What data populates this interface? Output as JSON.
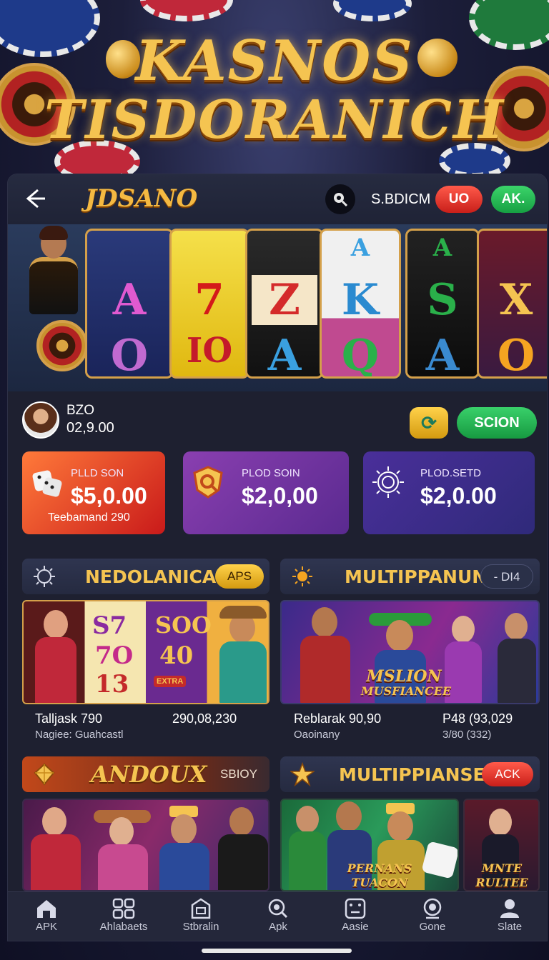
{
  "banner": {
    "line1": "KASNOS",
    "line2": "TISDORANICH"
  },
  "topbar": {
    "logo": "JDSANO",
    "user_label": "S.BDICM",
    "btn_red": "UO",
    "btn_green": "AK."
  },
  "slots": {
    "reels": [
      {
        "symbols": [
          "",
          "A",
          "O"
        ]
      },
      {
        "symbols": [
          "",
          "7",
          "IO"
        ]
      },
      {
        "symbols": [
          "",
          "Z",
          "A"
        ]
      },
      {
        "symbols": [
          "A",
          "K",
          "Q"
        ]
      },
      {
        "symbols": [
          "A",
          "S",
          "A"
        ]
      },
      {
        "symbols": [
          "",
          "X",
          "O"
        ]
      }
    ]
  },
  "profile": {
    "name": "BZO",
    "balance": "02,9.00",
    "login_label": "SCION"
  },
  "promo_cards": [
    {
      "label": "PLLD SON",
      "value": "$5,0.00",
      "sub": "Teebamand 290"
    },
    {
      "label": "PLOD SOIN",
      "value": "$2,0,00"
    },
    {
      "label": "PLOD.SETD",
      "value": "$2,0.00"
    }
  ],
  "sections": [
    {
      "title": "NEDOLANICA",
      "badge": "APS"
    },
    {
      "title": "MULTIPPANUN",
      "badge": "- DI4"
    },
    {
      "title": "ANDOUX",
      "badge": "SBIOY"
    },
    {
      "title": "MULTIPPIANSE",
      "badge": "ACK"
    }
  ],
  "game_cards": [
    {
      "name": "Talljask 790",
      "value": "290,08,230",
      "sub": "Nagiee: Guahcastl",
      "reel_text": [
        "S7",
        "7O",
        "13",
        "SOO",
        "40",
        "EXTRA"
      ]
    },
    {
      "name": "Reblarak 90,90",
      "value": "P48 (93,029",
      "sub": "Oaoinany",
      "sub2": "3/80 (332)",
      "art_text": [
        "MSLION",
        "MUSFIANCEE"
      ]
    }
  ],
  "bottom_art": {
    "left": "",
    "mid": [
      "PERNANS",
      "TUACON"
    ],
    "right": [
      "MNTE",
      "RULTEE"
    ]
  },
  "nav": [
    {
      "label": "APK",
      "icon": "home-icon"
    },
    {
      "label": "Ahlabaets",
      "icon": "grid-icon"
    },
    {
      "label": "Stbralin",
      "icon": "shop-icon"
    },
    {
      "label": "Apk",
      "icon": "search-icon"
    },
    {
      "label": "Aasie",
      "icon": "dice-icon"
    },
    {
      "label": "Gone",
      "icon": "chip-icon"
    },
    {
      "label": "Slate",
      "icon": "profile-icon"
    }
  ],
  "colors": {
    "gold": "#f5c451",
    "green": "#17a043",
    "red": "#c91f1a",
    "panel": "#1e2030"
  }
}
